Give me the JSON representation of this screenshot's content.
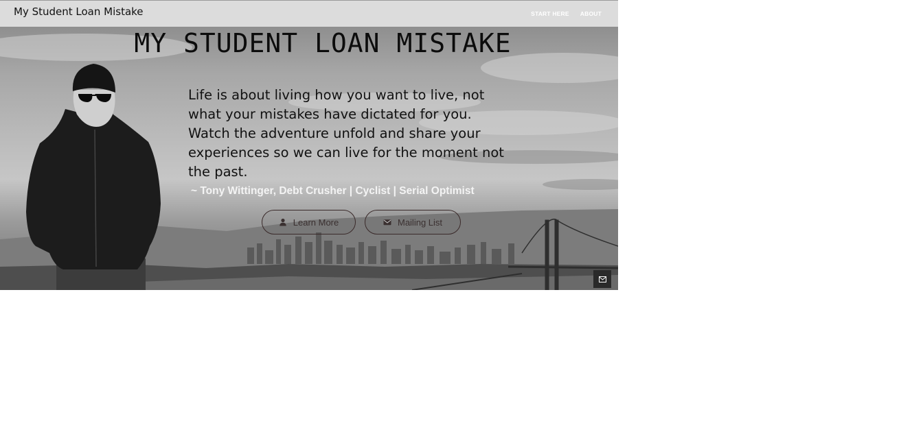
{
  "header": {
    "brand": "My Student Loan Mistake",
    "nav": [
      {
        "label": "START HERE"
      },
      {
        "label": "ABOUT"
      }
    ]
  },
  "hero": {
    "title": "MY STUDENT LOAN MISTAKE",
    "quote": "Life is about living how you want to live, not what your mistakes have dictated for you. Watch the adventure unfold and share your experiences so we can live for the moment not the past.",
    "attribution": "~ Tony Wittinger, Debt Crusher | Cyclist | Serial Optimist",
    "buttons": {
      "learn_more": {
        "label": "Learn More",
        "icon": "user-icon"
      },
      "mailing_list": {
        "label": "Mailing List",
        "icon": "envelope-icon"
      }
    }
  },
  "floating": {
    "icon": "envelope-icon"
  },
  "colors": {
    "topbar": "#dcdcdc",
    "button_border": "#3a2a2a",
    "attribution_text": "#f4f4f4"
  }
}
